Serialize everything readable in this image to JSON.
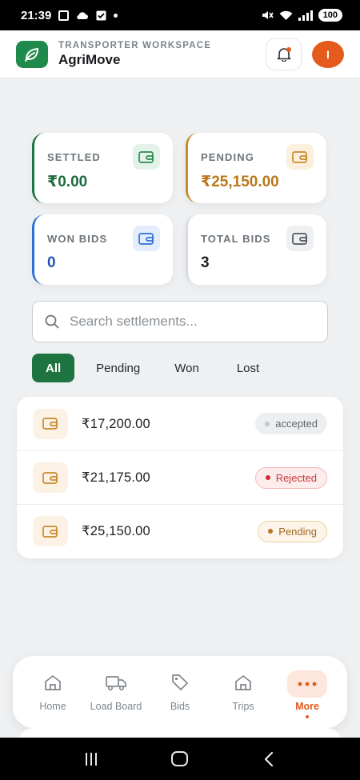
{
  "status_bar": {
    "time": "21:39",
    "battery": "100"
  },
  "header": {
    "workspace_label": "TRANSPORTER WORKSPACE",
    "app_name": "AgriMove",
    "avatar_initial": "I"
  },
  "stats": [
    {
      "label": "SETTLED",
      "value": "₹0.00",
      "accent": "#1e7441",
      "value_color": "#1e6b3c",
      "icon_bg": "#e4f3e9",
      "icon_color": "#2c8a50"
    },
    {
      "label": "PENDING",
      "value": "₹25,150.00",
      "accent": "#c98a2c",
      "value_color": "#b9781c",
      "icon_bg": "#fbf0de",
      "icon_color": "#c98a2c"
    },
    {
      "label": "WON BIDS",
      "value": "0",
      "accent": "#2f6fd6",
      "value_color": "#2556b3",
      "icon_bg": "#e3edfb",
      "icon_color": "#2f6fd6"
    },
    {
      "label": "TOTAL BIDS",
      "value": "3",
      "accent": "#d8dbdf",
      "value_color": "#1b1f23",
      "icon_bg": "#eef0f2",
      "icon_color": "#4f565c"
    }
  ],
  "search": {
    "placeholder": "Search settlements..."
  },
  "filters": {
    "all": "All",
    "pending": "Pending",
    "won": "Won",
    "lost": "Lost",
    "active": "All"
  },
  "settlements": [
    {
      "amount": "₹17,200.00",
      "status": "accepted"
    },
    {
      "amount": "₹21,175.00",
      "status": "Rejected"
    },
    {
      "amount": "₹25,150.00",
      "status": "Pending"
    }
  ],
  "bottom_nav": {
    "home": "Home",
    "load_board": "Load Board",
    "bids": "Bids",
    "trips": "Trips",
    "more": "More",
    "active": "More"
  },
  "colors": {
    "brand_green": "#1f8a4c",
    "accent_orange": "#e55b1d"
  }
}
